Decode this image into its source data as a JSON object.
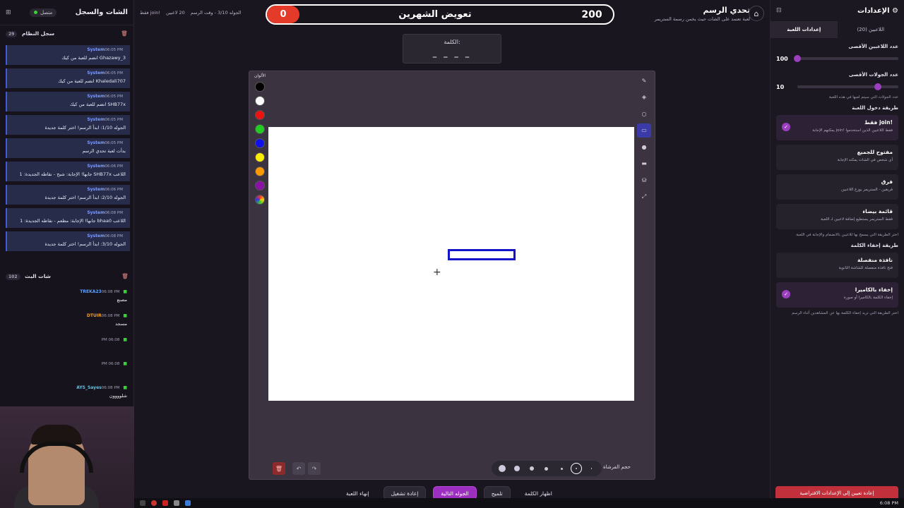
{
  "left_panel": {
    "title": "الشات والسجل",
    "connection": "متصل",
    "system_log": {
      "title": "سجل النظام",
      "count": "29",
      "messages": [
        {
          "who": "System",
          "time": "06:05 PM",
          "text": "Ghazawy_3 انضم للعبة من كيك"
        },
        {
          "who": "System",
          "time": "06:05 PM",
          "text": "Khaledali707 انضم للعبة من كيك"
        },
        {
          "who": "System",
          "time": "06:05 PM",
          "text": "SHB77x انضم للعبة من كيك"
        },
        {
          "who": "System",
          "time": "06:05 PM",
          "text": "الجوله 1/10: ابدأ الرسم! اختر كلمة جديدة"
        },
        {
          "who": "System",
          "time": "06:05 PM",
          "text": "بدأت لعبة تحدي الرسم"
        },
        {
          "who": "System",
          "time": "06:06 PM",
          "text": "اللاعب SHB77x جابها! الإجابة: شبح - نقاطه الجديدة: 1"
        },
        {
          "who": "System",
          "time": "06:06 PM",
          "text": "الجوله 2/10: ابدأ الرسم! اختر كلمة جديدة"
        },
        {
          "who": "System",
          "time": "06:08 PM",
          "text": "اللاعب bhaa0 جابها! الإجابة: مطعم - نقاطه الجديدة: 1"
        },
        {
          "who": "System",
          "time": "06:08 PM",
          "text": "الجوله 3/10: ابدأ الرسم! اختر كلمة جديدة"
        }
      ]
    },
    "broadcast_chat": {
      "title": "شات البث",
      "count": "102",
      "messages": [
        {
          "name": "TREKA23",
          "time": "06:08 PM",
          "text": "مصنع",
          "color": "#5aa0ff"
        },
        {
          "name": "DTUIR",
          "time": "06:08 PM",
          "text": "مسجد",
          "color": "#f0a030"
        },
        {
          "name": "",
          "time": "06:08 PM",
          "text": "",
          "color": "#c04040"
        },
        {
          "name": "",
          "time": "06:08 PM",
          "text": "",
          "color": "#c04040"
        },
        {
          "name": "AYS_Sayes",
          "time": "06:08 PM",
          "text": "شلوووون",
          "color": "#5ac8e8"
        }
      ]
    }
  },
  "top": {
    "round_info": "الجوله 3/10 - وقت الرسم",
    "players_info": "20 لاعبين",
    "mode": "!join فقط",
    "left_score": "0",
    "word": "تعويض الشهرين",
    "right_score": "200",
    "game_title": "تحدي الرسم",
    "game_subtitle": "لعبة تعتمد على الشات حيث يخمن رسمة الستريمر"
  },
  "word_box": {
    "label": "الكلمة:",
    "blanks": "_ _ _ _"
  },
  "canvas": {
    "colors_label": "الألوان",
    "palette": [
      "#000000",
      "#ffffff",
      "#ee1111",
      "#22cc22",
      "#1111ee",
      "#ffee00",
      "#ff9900",
      "#8a10a8"
    ],
    "stroke_color": "#1414c8",
    "brush_size_label": "حجم الفرشاة"
  },
  "bottom_buttons": {
    "show_word": "اظهار الكلمة",
    "hint": "تلميح",
    "next_round": "الجوله التالية",
    "restart": "إعادة تشغيل",
    "end_game": "إنهاء اللعبة"
  },
  "right_panel": {
    "title": "الإعدادات",
    "tab_game": "إعدادات اللعبة",
    "tab_players": "اللاعبين (20)",
    "max_players_label": "عدد اللاعبين الأقصى",
    "max_players_value": "100",
    "max_players_fraction": 1.0,
    "max_rounds_label": "عدد الجولات الأقصى",
    "max_rounds_value": "10",
    "max_rounds_fraction": 0.2,
    "max_rounds_hint": "عدد الجولات التي سيتم لعبها في هذه اللعبة",
    "entry_method_label": "طريقة دخول اللعبة",
    "entry_options": [
      {
        "title": "!join فقط",
        "desc": "فقط اللاعبين الذين استخدموا !join يمكنهم الإجابة",
        "selected": true
      },
      {
        "title": "مفتوح للجميع",
        "desc": "أي شخص في الشات يمكنه الإجابة",
        "selected": false
      },
      {
        "title": "فرق",
        "desc": "فريقين - الستريمر يوزع اللاعبين",
        "selected": false
      },
      {
        "title": "قائمة بيضاء",
        "desc": "فقط الستريمر يستطيع إضافة لاعبين لـ اللعبة",
        "selected": false
      }
    ],
    "entry_hint": "اختر الطريقة التي يسمح بها للاعبين بالانضمام والإجابة في اللعبة",
    "hide_method_label": "طريقة إخفاء الكلمة",
    "hide_options": [
      {
        "title": "نافذة منفصلة",
        "desc": "فتح نافذة منفصلة للشاشة الثانوية",
        "selected": false
      },
      {
        "title": "إخفاء بالكاميرا",
        "desc": "إخفاء الكلمة بالكاميرا أو صورة",
        "selected": true
      }
    ],
    "hide_hint": "اختر الطريقة التي تريد إخفاء الكلمة بها عن المشاهدين أثناء الرسم",
    "reset_button": "إعادة تعيين إلى الإعدادات الافتراضية"
  },
  "taskbar": {
    "time": "6:08 PM"
  }
}
